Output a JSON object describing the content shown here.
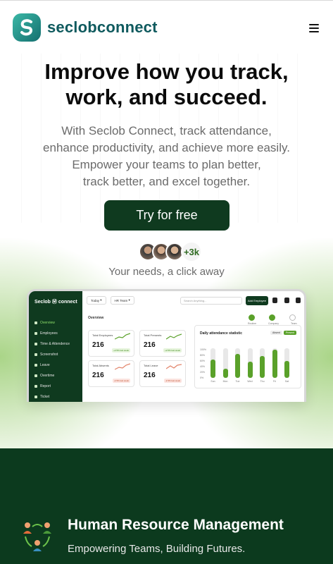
{
  "header": {
    "brand": "seclobconnect",
    "menu_icon": "hamburger-icon"
  },
  "hero": {
    "headline_line1": "Improve how you track,",
    "headline_line2": "work, and succeed.",
    "subtext_line1": "With Seclob Connect, track attendance,",
    "subtext_line2": "enhance productivity, and achieve more easily.",
    "subtext_line3": "Empower your teams to plan better,",
    "subtext_line4": "track better, and excel together.",
    "cta_label": "Try for free",
    "avatar_count": "+3k",
    "avatars_caption": "Your needs, a click away"
  },
  "dashboard": {
    "logo": "Seclob Ⓜ connect",
    "sidebar": [
      {
        "label": "Overview",
        "active": true
      },
      {
        "label": "Employees"
      },
      {
        "label": "Time & Attendence"
      },
      {
        "label": "Screenshot"
      },
      {
        "label": "Leave"
      },
      {
        "label": "Overtime"
      },
      {
        "label": "Report"
      },
      {
        "label": "Ticket"
      }
    ],
    "filter_day": "Today",
    "filter_team": "HR Team",
    "search_placeholder": "Search Anything...",
    "add_button": "Add Employee",
    "page_title": "Overview",
    "steps": [
      "Routine",
      "Company",
      "Team"
    ],
    "stats": [
      {
        "label": "Total Employees",
        "value": "216",
        "tag": "+2.5% last week",
        "trend": "up"
      },
      {
        "label": "Total Presents",
        "value": "216",
        "tag": "+2.5% last week",
        "trend": "up"
      },
      {
        "label": "Total Absents",
        "value": "216",
        "tag": "-2.5% last week",
        "trend": "down"
      },
      {
        "label": "Total Leave",
        "value": "216",
        "tag": "-2.5% last week",
        "trend": "down"
      }
    ],
    "chart": {
      "title": "Daily attendance statistic",
      "tab_absent": "Absent",
      "tab_present": "Present",
      "y_ticks": [
        "100%",
        "80%",
        "60%",
        "40%",
        "20%",
        "0%"
      ]
    },
    "accent_color": "#5aa12a",
    "sidebar_color": "#0f3a1f"
  },
  "chart_data": {
    "type": "bar",
    "title": "Daily attendance statistic",
    "categories": [
      "Sun",
      "Mon",
      "Tue",
      "Wed",
      "Thu",
      "Fri",
      "Sat"
    ],
    "values": [
      62,
      32,
      80,
      55,
      75,
      95,
      58
    ],
    "ylim": [
      0,
      100
    ]
  },
  "footer_section": {
    "title": "Human Resource Management",
    "subtitle": "Empowering Teams, Building Futures.",
    "background": "#0c3a1e"
  }
}
